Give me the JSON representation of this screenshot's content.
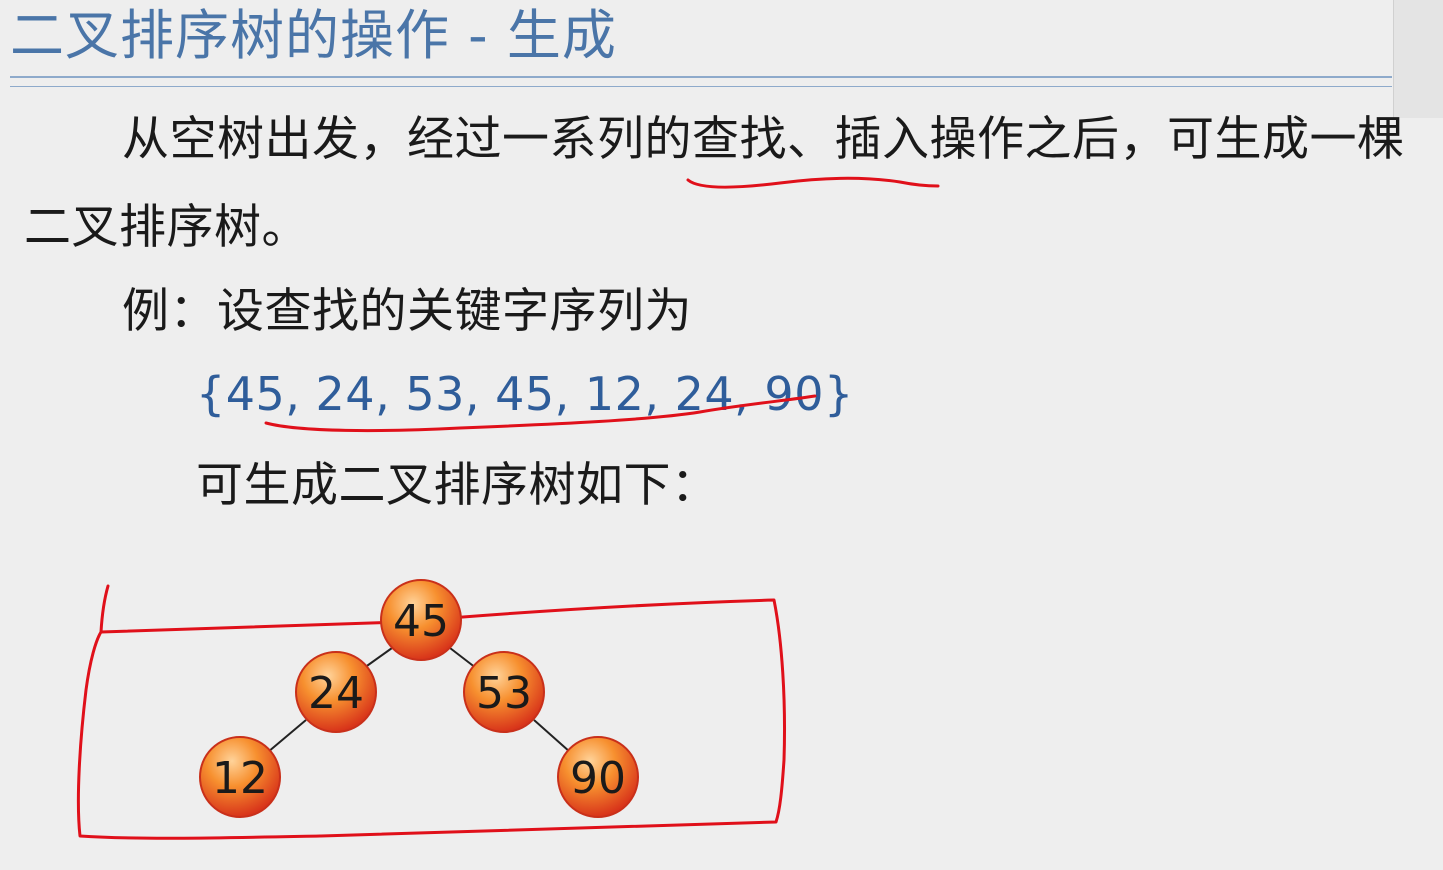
{
  "slide": {
    "title": "二叉排序树的操作 - 生成"
  },
  "content": {
    "line1": "从空树出发，经过一系列的查找、插入操作之后，可生成一棵",
    "line2": "二叉排序树。",
    "line3": "例：设查找的关键字序列为",
    "sequence": "{45, 24, 53, 45, 12, 24, 90}",
    "line5": "可生成二叉排序树如下："
  },
  "tree": {
    "nodes": [
      {
        "id": "n45",
        "label": "45"
      },
      {
        "id": "n24",
        "label": "24"
      },
      {
        "id": "n53",
        "label": "53"
      },
      {
        "id": "n12",
        "label": "12"
      },
      {
        "id": "n90",
        "label": "90"
      }
    ],
    "edges": [
      [
        "n45",
        "n24"
      ],
      [
        "n45",
        "n53"
      ],
      [
        "n24",
        "n12"
      ],
      [
        "n53",
        "n90"
      ]
    ]
  },
  "colors": {
    "title": "#4a75a8",
    "sequence_text": "#2f5d9a",
    "annotation_ink": "#e0101a",
    "node_fill_dark": "#e8401a",
    "node_fill_light": "#ffd39a"
  }
}
